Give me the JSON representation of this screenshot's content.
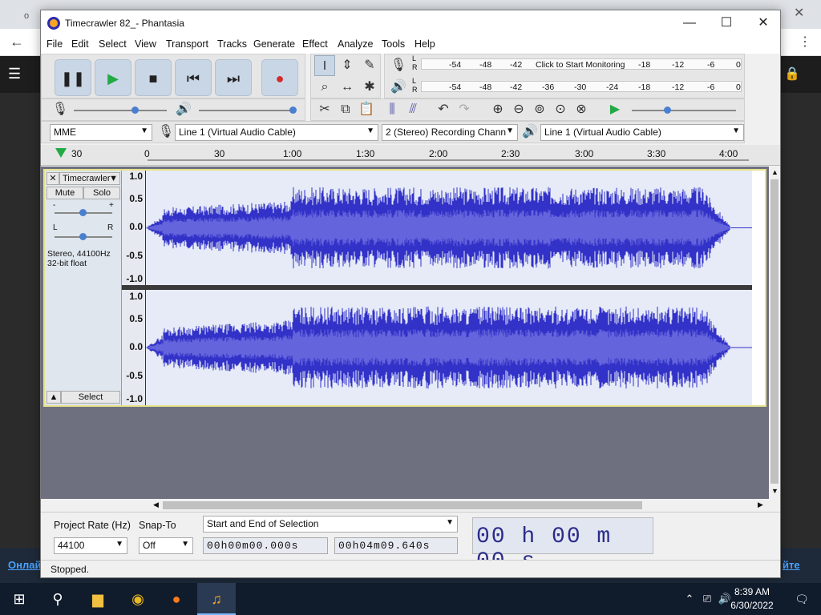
{
  "browser": {
    "tabs": [
      "o",
      "(",
      "F",
      "(",
      "S"
    ],
    "bottom_link_left": "Онлай",
    "bottom_link_right": "йте"
  },
  "window": {
    "title": "Timecrawler 82_- Phantasia",
    "minimize": "—",
    "maximize": "☐",
    "close": "✕"
  },
  "menu": [
    "File",
    "Edit",
    "Select",
    "View",
    "Transport",
    "Tracks",
    "Generate",
    "Effect",
    "Analyze",
    "Tools",
    "Help"
  ],
  "meters": {
    "record_ticks": [
      "-54",
      "-48",
      "-42",
      "Click to Start Monitoring",
      "-18",
      "-12",
      "-6",
      "0"
    ],
    "play_ticks": [
      "-54",
      "-48",
      "-42",
      "-36",
      "-30",
      "-24",
      "-18",
      "-12",
      "-6",
      "0"
    ],
    "lr": [
      "L",
      "R"
    ]
  },
  "devices": {
    "host": "MME",
    "recording_device": "Line 1 (Virtual Audio Cable)",
    "channels": "2 (Stereo) Recording Chann",
    "playback_device": "Line 1 (Virtual Audio Cable)"
  },
  "ruler": {
    "labels": [
      "30",
      "0",
      "30",
      "1:00",
      "1:30",
      "2:00",
      "2:30",
      "3:00",
      "3:30",
      "4:00"
    ]
  },
  "track": {
    "name": "Timecrawler",
    "close": "✕",
    "mute": "Mute",
    "solo": "Solo",
    "gain_minus": "-",
    "gain_plus": "+",
    "pan_l": "L",
    "pan_r": "R",
    "info_line1": "Stereo, 44100Hz",
    "info_line2": "32-bit float",
    "select": "Select",
    "amp_labels": [
      "1.0",
      "0.5",
      "0.0",
      "-0.5",
      "-1.0"
    ]
  },
  "selection": {
    "project_rate_label": "Project Rate (Hz)",
    "project_rate": "44100",
    "snap_label": "Snap-To",
    "snap_value": "Off",
    "mode": "Start and End of Selection",
    "start": "00h00m00.000s",
    "end": "00h04m09.640s",
    "time_display": "00 h 00 m 00 s"
  },
  "status": "Stopped.",
  "taskbar": {
    "time": "8:39 AM",
    "date": "6/30/2022",
    "notif_count": "1"
  },
  "colors": {
    "waveform": "#3232c8",
    "waveform_rms": "#6464dc",
    "track_bg": "#e6ebf7",
    "accent_green": "#22aa44",
    "record_red": "#d42b2b"
  }
}
